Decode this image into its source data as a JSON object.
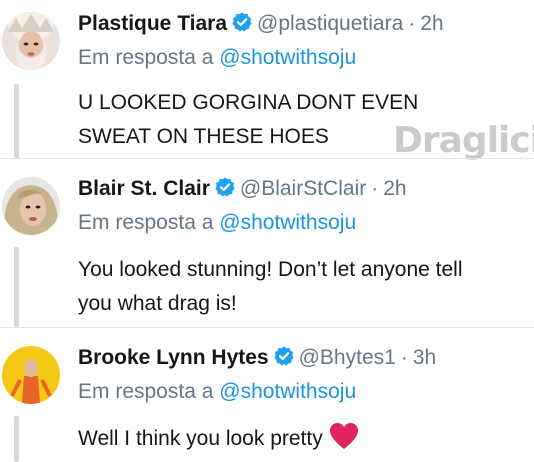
{
  "colors": {
    "name": "#14171a",
    "meta": "#657786",
    "link": "#1b95e0",
    "verified_badge": "#1da1f2",
    "heart": "#e0245e"
  },
  "watermark_text": "Draglicious",
  "tweets": [
    {
      "display_name": "Plastique Tiara",
      "verified_icon": "verified-badge-icon",
      "handle": "@plastiquetiara",
      "separator": "·",
      "time": "2h",
      "reply_prefix": "Em resposta a",
      "reply_to": "@shotwithsoju",
      "text_line1": "U LOOKED GORGINA DONT EVEN",
      "text_line2": "SWEAT ON THESE HOES"
    },
    {
      "display_name": "Blair St. Clair",
      "verified_icon": "verified-badge-icon",
      "handle": "@BlairStClair",
      "separator": "·",
      "time": "2h",
      "reply_prefix": "Em resposta a",
      "reply_to": "@shotwithsoju",
      "text_line1": "You looked stunning! Don’t let anyone tell",
      "text_line2": "you what drag is!"
    },
    {
      "display_name": "Brooke Lynn Hytes",
      "verified_icon": "verified-badge-icon",
      "handle": "@Bhytes1",
      "separator": "·",
      "time": "3h",
      "reply_prefix": "Em resposta a",
      "reply_to": "@shotwithsoju",
      "text_line1": "Well I think you look pretty",
      "emoji_icon": "red-heart-icon"
    }
  ]
}
